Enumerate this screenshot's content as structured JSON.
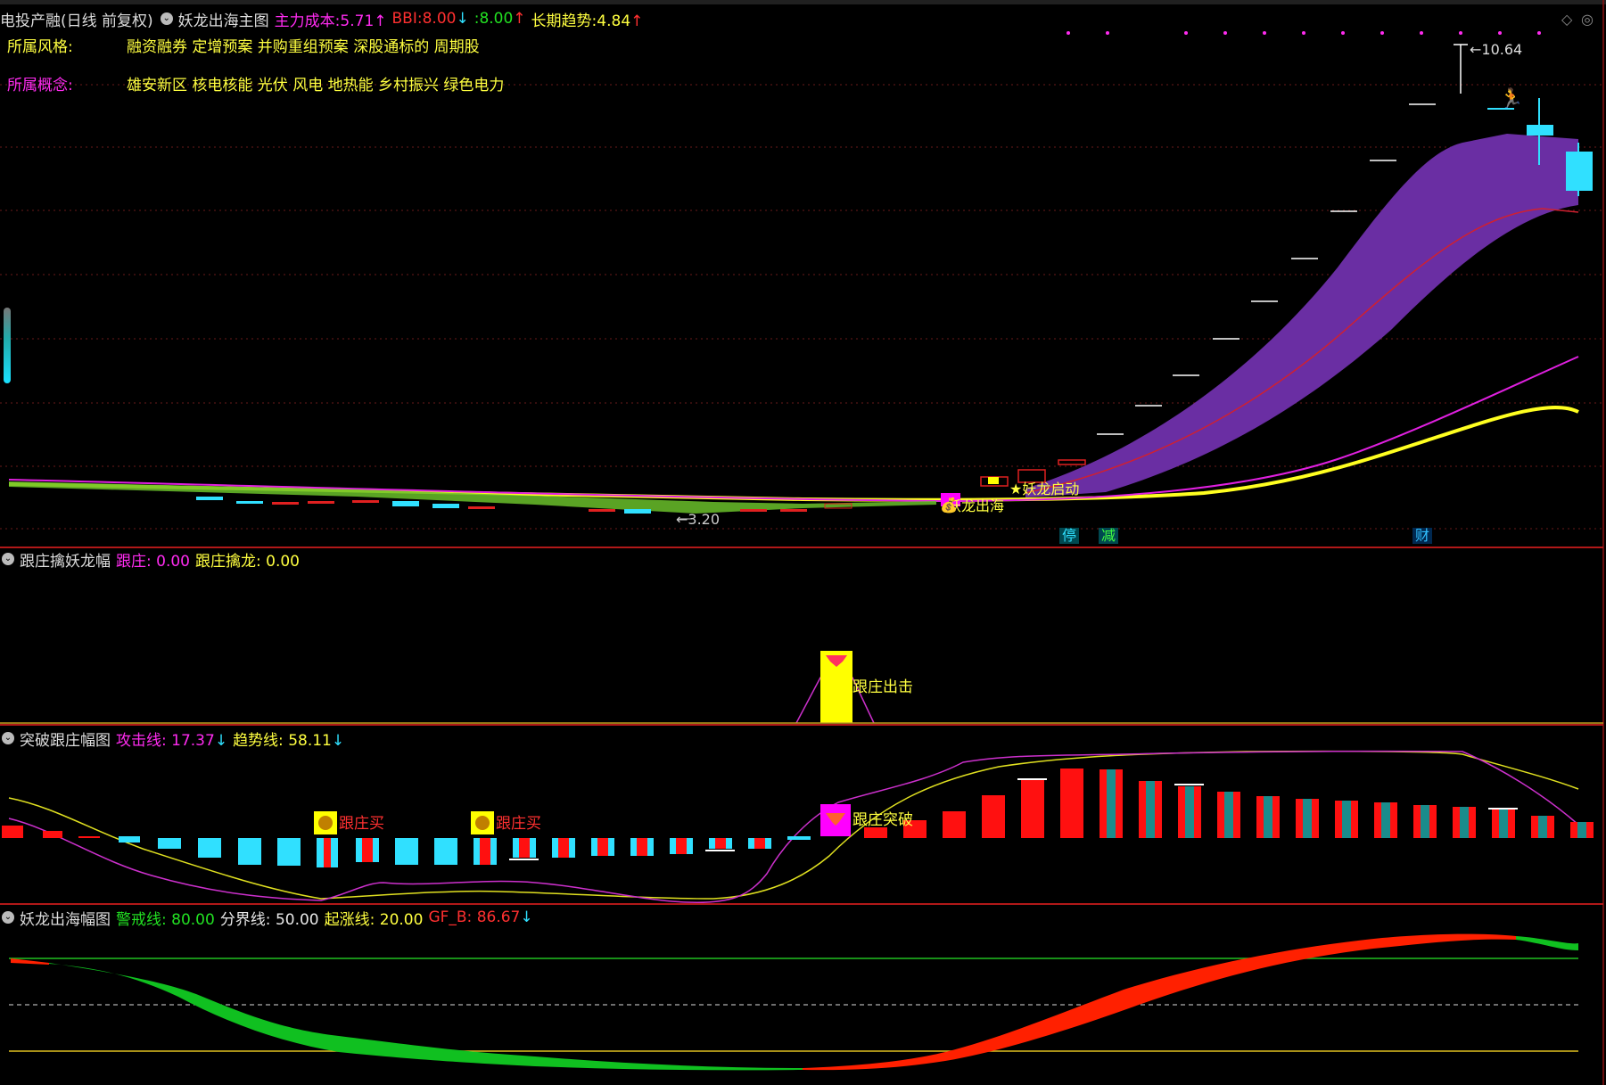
{
  "main": {
    "stock_title": "电投产融(日线 前复权)",
    "indicator_name": "妖龙出海主图",
    "stats": [
      {
        "label": "主力成本:",
        "value": "5.71",
        "arrow": "↑",
        "color": "#ff2bf0"
      },
      {
        "label": "BBI:",
        "value": "8.00",
        "arrow": "↓",
        "color": "#ff3030"
      },
      {
        "label": ":",
        "value": "8.00",
        "arrow": "↑",
        "color": "#22e022"
      },
      {
        "label": "长期趋势:",
        "value": "4.84",
        "arrow": "↑",
        "color": "#ffff40"
      }
    ],
    "style_label": "所属风格:",
    "style_value": "融资融券 定增预案 并购重组预案 深股通标的 周期股",
    "concept_label": "所属概念:",
    "concept_value": "雄安新区 核电核能 光伏 风电 地热能 乡村振兴 绿色电力",
    "high_price": "10.64",
    "low_price": "3.20",
    "signal_yaolong_chuhai": "妖龙出海",
    "signal_yaolong_qidong": "妖龙启动",
    "markers": [
      "停",
      "减",
      "财"
    ]
  },
  "panel2": {
    "title": "跟庄擒妖龙幅",
    "stats": [
      {
        "label": "跟庄:",
        "value": "0.00",
        "color": "#ff2bf0"
      },
      {
        "label": "跟庄擒龙:",
        "value": "0.00",
        "color": "#ffff40"
      }
    ],
    "signal": "跟庄出击"
  },
  "panel3": {
    "title": "突破跟庄幅图",
    "stats": [
      {
        "label": "攻击线:",
        "value": "17.37",
        "arrow": "↓",
        "color": "#ff2bf0"
      },
      {
        "label": "趋势线:",
        "value": "58.11",
        "arrow": "↓",
        "color": "#ffff40"
      }
    ],
    "signal_buy": "跟庄买",
    "signal_break": "跟庄突破"
  },
  "panel4": {
    "title": "妖龙出海幅图",
    "stats": [
      {
        "label": "警戒线:",
        "value": "80.00",
        "color": "#22e022"
      },
      {
        "label": "分界线:",
        "value": "50.00",
        "color": "#e8e8e8"
      },
      {
        "label": "起涨线:",
        "value": "20.00",
        "color": "#ffff40"
      },
      {
        "label": "GF_B:",
        "value": "86.67",
        "arrow": "↓",
        "color": "#ff3030"
      }
    ]
  }
}
